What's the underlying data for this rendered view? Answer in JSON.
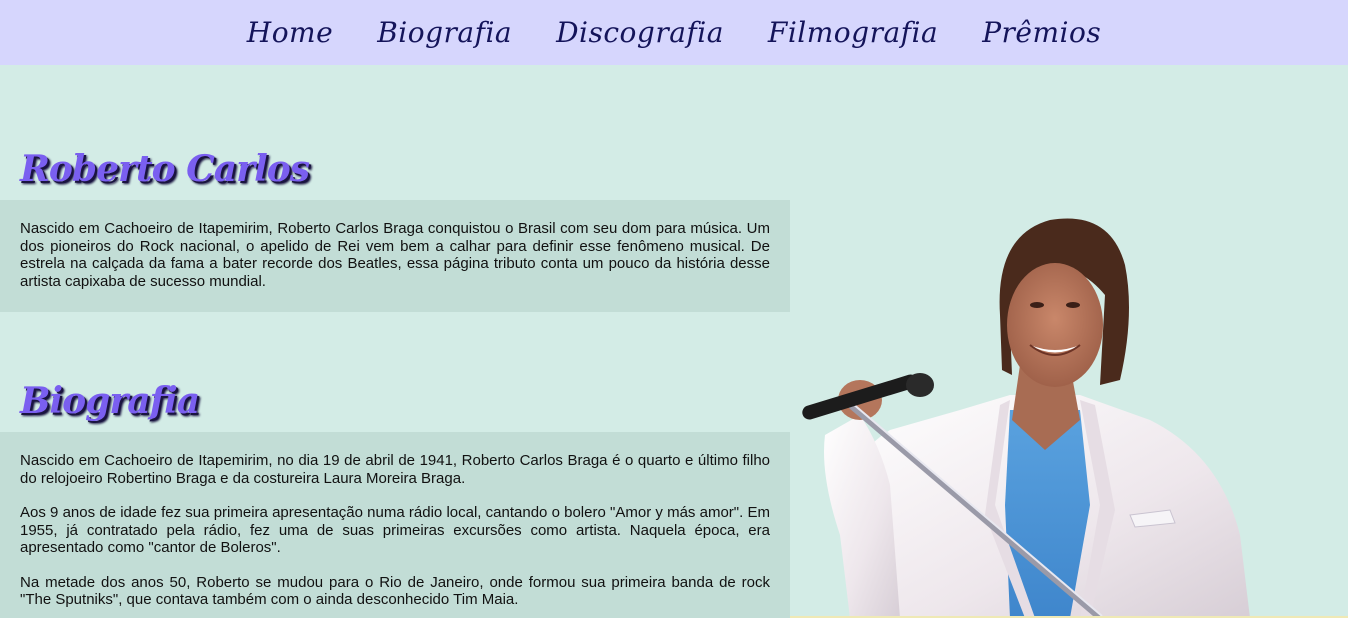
{
  "nav": {
    "items": [
      {
        "label": "Home"
      },
      {
        "label": "Biografia"
      },
      {
        "label": "Discografia"
      },
      {
        "label": "Filmografia"
      },
      {
        "label": "Prêmios"
      }
    ]
  },
  "intro": {
    "title": "Roberto Carlos",
    "paragraph": "Nascido em Cachoeiro de Itapemirim, Roberto Carlos Braga conquistou o Brasil com seu dom para música. Um dos pioneiros do Rock nacional, o apelido de Rei vem bem a calhar para definir esse fenômeno musical. De estrela na calçada da fama a bater recorde dos Beatles, essa página tributo conta um pouco da história desse artista capixaba de sucesso mundial."
  },
  "biografia": {
    "title": "Biografia",
    "paragraphs": [
      "Nascido em Cachoeiro de Itapemirim, no dia 19 de abril de 1941, Roberto Carlos Braga é o quarto e último filho do relojoeiro Robertino Braga e da costureira Laura Moreira Braga.",
      "Aos 9 anos de idade fez sua primeira apresentação numa rádio local, cantando o bolero \"Amor y más amor\". Em 1955, já contratado pela rádio, fez uma de suas primeiras excursões como artista. Naquela época, era apresentado como \"cantor de Boleros\".",
      "Na metade dos anos 50, Roberto se mudou para o Rio de Janeiro, onde formou sua primeira banda de rock \"The Sputniks\", que contava também com o ainda desconhecido Tim Maia."
    ]
  },
  "colors": {
    "nav_bg": "#d6d6fd",
    "page_bg": "#d3ece6",
    "box_bg": "#c2ddd6",
    "title": "#7a5ff0",
    "nav_text": "#14145a"
  }
}
